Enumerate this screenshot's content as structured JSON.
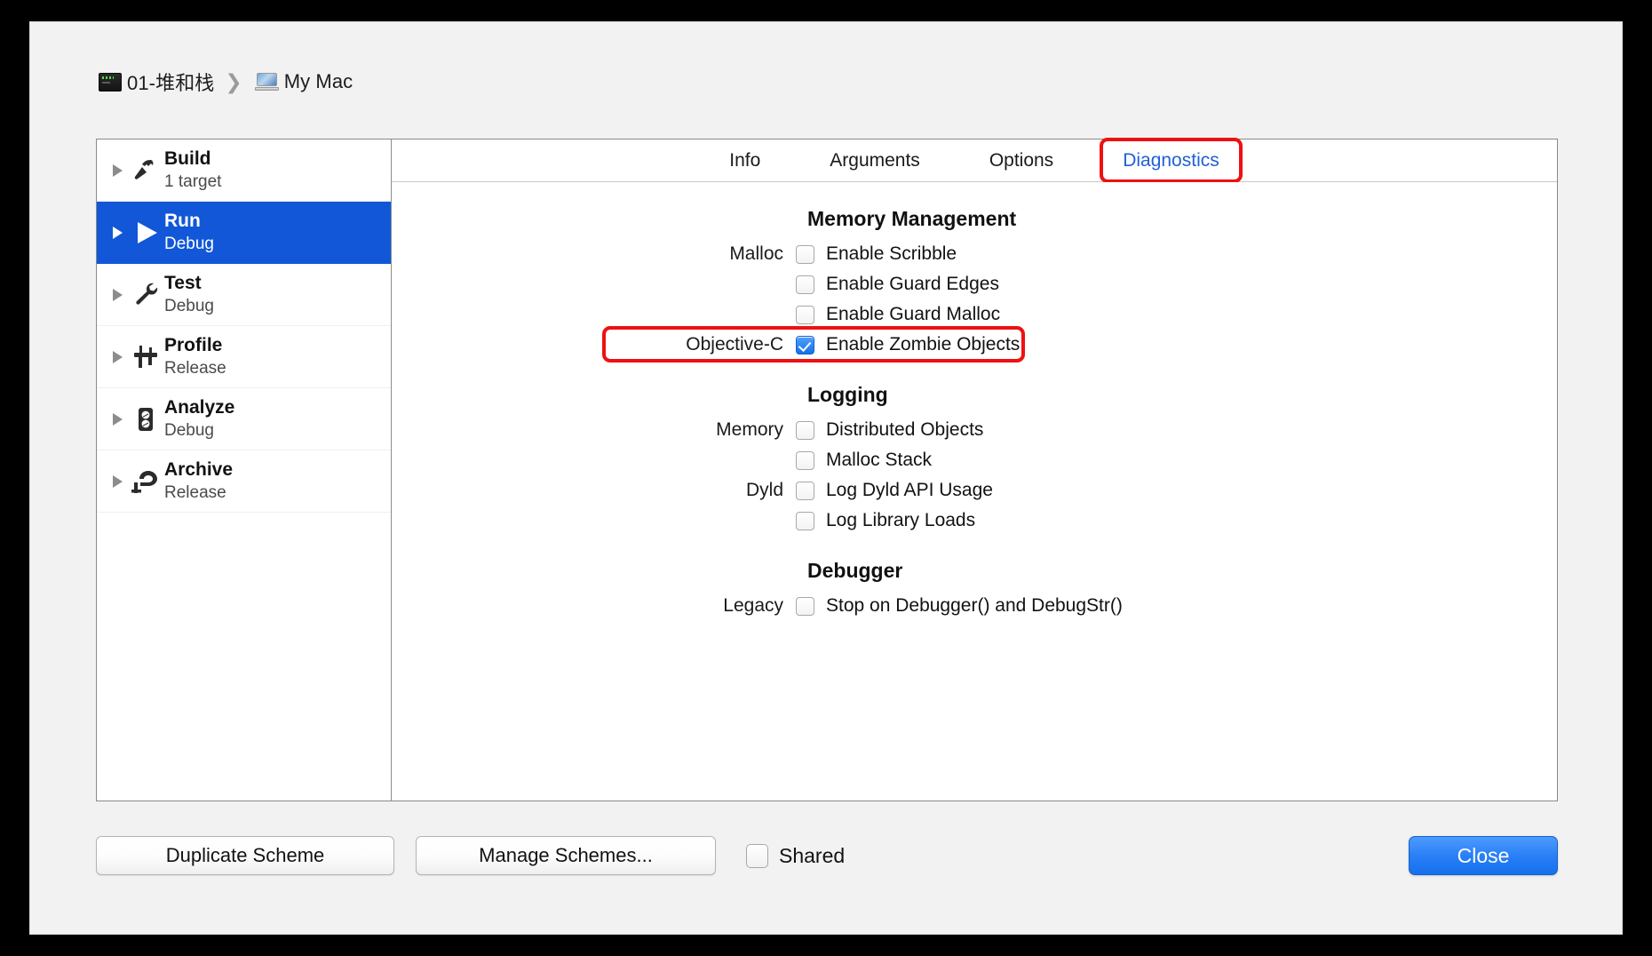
{
  "window": {
    "breadcrumb": {
      "project": "01-堆和栈",
      "separator": "❯",
      "destination": "My Mac"
    }
  },
  "sidebar": {
    "items": [
      {
        "title": "Build",
        "subtitle": "1 target",
        "icon": "hammer-icon",
        "selected": false
      },
      {
        "title": "Run",
        "subtitle": "Debug",
        "icon": "play-icon",
        "selected": true
      },
      {
        "title": "Test",
        "subtitle": "Debug",
        "icon": "wrench-icon",
        "selected": false
      },
      {
        "title": "Profile",
        "subtitle": "Release",
        "icon": "caliper-icon",
        "selected": false
      },
      {
        "title": "Analyze",
        "subtitle": "Debug",
        "icon": "multimeter-icon",
        "selected": false
      },
      {
        "title": "Archive",
        "subtitle": "Release",
        "icon": "clamp-icon",
        "selected": false
      }
    ]
  },
  "tabs": [
    {
      "label": "Info",
      "active": false,
      "annotated": false
    },
    {
      "label": "Arguments",
      "active": false,
      "annotated": false
    },
    {
      "label": "Options",
      "active": false,
      "annotated": false
    },
    {
      "label": "Diagnostics",
      "active": true,
      "annotated": true
    }
  ],
  "diagnostics": {
    "groups": [
      {
        "heading": "Memory Management",
        "rows": [
          {
            "label": "Malloc",
            "checkbox": "Enable Scribble",
            "checked": false,
            "annotated": false
          },
          {
            "label": "",
            "checkbox": "Enable Guard Edges",
            "checked": false,
            "annotated": false
          },
          {
            "label": "",
            "checkbox": "Enable Guard Malloc",
            "checked": false,
            "annotated": false
          },
          {
            "label": "Objective-C",
            "checkbox": "Enable Zombie Objects",
            "checked": true,
            "annotated": true
          }
        ]
      },
      {
        "heading": "Logging",
        "rows": [
          {
            "label": "Memory",
            "checkbox": "Distributed Objects",
            "checked": false,
            "annotated": false
          },
          {
            "label": "",
            "checkbox": "Malloc Stack",
            "checked": false,
            "annotated": false
          },
          {
            "label": "Dyld",
            "checkbox": "Log Dyld API Usage",
            "checked": false,
            "annotated": false
          },
          {
            "label": "",
            "checkbox": "Log Library Loads",
            "checked": false,
            "annotated": false
          }
        ]
      },
      {
        "heading": "Debugger",
        "rows": [
          {
            "label": "Legacy",
            "checkbox": "Stop on Debugger() and DebugStr()",
            "checked": false,
            "annotated": false
          }
        ]
      }
    ]
  },
  "bottom_bar": {
    "duplicate_label": "Duplicate Scheme",
    "manage_label": "Manage Schemes...",
    "shared_label": "Shared",
    "shared_checked": false,
    "close_label": "Close"
  },
  "colors": {
    "selection_blue": "#1157d8",
    "accent_blue": "#2060d8",
    "annotation_red": "#ee1111",
    "default_button_blue": "#2a80f5",
    "window_bg": "#f2f2f2",
    "pane_bg": "#ffffff"
  }
}
